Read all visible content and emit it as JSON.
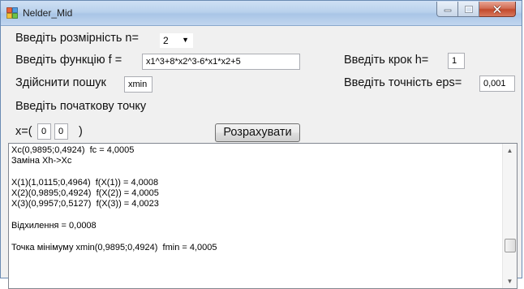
{
  "window": {
    "title": "Nelder_Mid"
  },
  "form": {
    "dimension_label": "Введіть розмірність n=",
    "dimension_value": "2",
    "function_label": "Введіть функцію f =",
    "function_value": "x1^3+8*x2^3-6*x1*x2+5",
    "step_label": "Введіть крок  h=",
    "step_value": "1",
    "search_label": "Здійснити пошук",
    "search_value": "xmin",
    "eps_label": "Введіть точність eps=",
    "eps_value": "0,001",
    "start_point_label": "Введіть початкову точку",
    "x_prefix": "x=(",
    "x1_value": "0",
    "x2_value": "0",
    "x_suffix": ")",
    "calculate_button": "Розрахувати"
  },
  "output": {
    "lines": [
      "Xc(0,9895;0,4924)  fc = 4,0005",
      "Заміна Xh->Xc",
      "",
      "X(1)(1,0115;0,4964)  f(X(1)) = 4,0008",
      "X(2)(0,9895;0,4924)  f(X(2)) = 4,0005",
      "X(3)(0,9957;0,5127)  f(X(3)) = 4,0023",
      "",
      "Відхилення = 0,0008",
      "",
      "Точка мінімуму xmin(0,9895;0,4924)  fmin = 4,0005"
    ]
  },
  "colors": {
    "titlebar": "#b9d1ec",
    "close_button": "#c24a2c",
    "form_background": "#f0f0f0"
  }
}
